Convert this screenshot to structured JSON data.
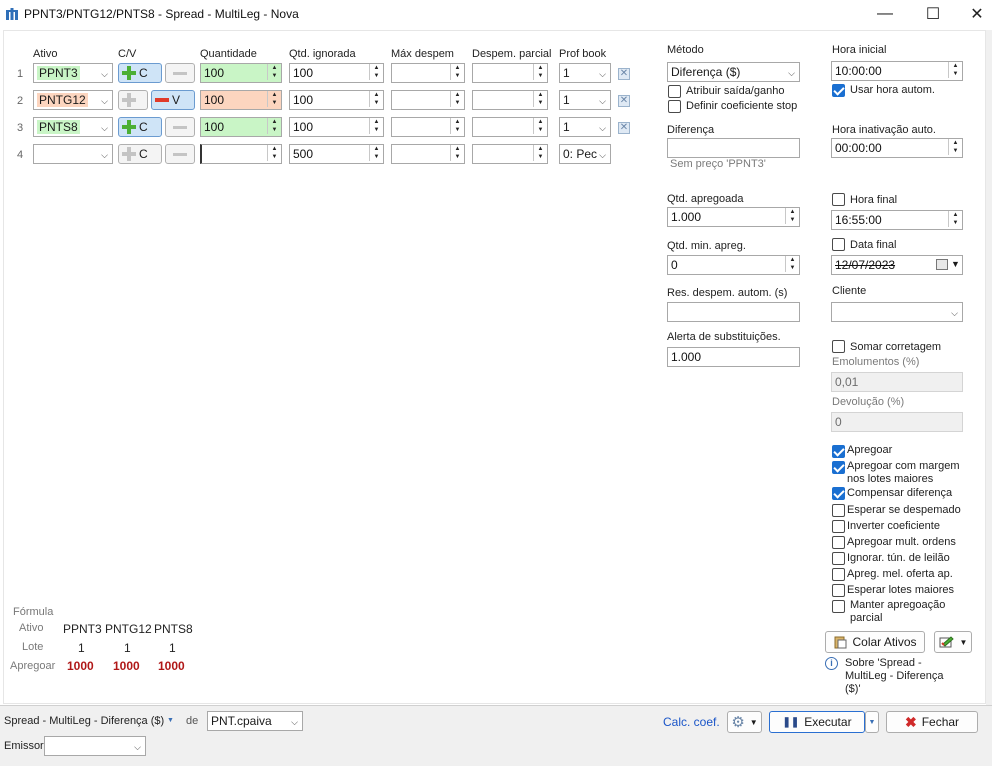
{
  "window": {
    "title": "PPNT3/PNTG12/PNTS8 - Spread - MultiLeg - Nova",
    "min_glyph": "—",
    "max_glyph": "☐",
    "close_glyph": "✕"
  },
  "legs": {
    "headers": {
      "ativo": "Ativo",
      "cv": "C/V",
      "quantidade": "Quantidade",
      "qtd_ignorada": "Qtd. ignorada",
      "max_despem": "Máx despem",
      "despem_parcial": "Despem. parcial",
      "prof_book": "Prof book"
    },
    "rows": [
      {
        "num": "1",
        "ativo": "PPNT3",
        "cv": "C",
        "quantidade": "100",
        "qtd_ignorada": "100",
        "max_despem": "",
        "despem_parcial": "",
        "prof_book": "1"
      },
      {
        "num": "2",
        "ativo": "PNTG12",
        "cv": "V",
        "quantidade": "100",
        "qtd_ignorada": "100",
        "max_despem": "",
        "despem_parcial": "",
        "prof_book": "1"
      },
      {
        "num": "3",
        "ativo": "PNTS8",
        "cv": "C",
        "quantidade": "100",
        "qtd_ignorada": "100",
        "max_despem": "",
        "despem_parcial": "",
        "prof_book": "1"
      },
      {
        "num": "4",
        "ativo": "",
        "cv": "C",
        "quantidade": "",
        "qtd_ignorada": "500",
        "max_despem": "",
        "despem_parcial": "",
        "prof_book": "0: Pec"
      }
    ],
    "c_label": "C",
    "v_label": "V"
  },
  "metodo": {
    "label": "Método",
    "value": "Diferença ($)",
    "atribuir": "Atribuir saída/ganho",
    "definir": "Definir coeficiente stop",
    "diferenca_label": "Diferença",
    "diferenca_value": "",
    "sem_preco": "Sem preço 'PPNT3'",
    "qtd_apregoada_label": "Qtd. apregoada",
    "qtd_apregoada": "1.000",
    "qtd_min_label": "Qtd. min. apreg.",
    "qtd_min": "0",
    "res_despem_label": "Res. despem. autom. (s)",
    "res_despem": "",
    "alerta_label": "Alerta de substituições.",
    "alerta": "1.000"
  },
  "tempo": {
    "hora_inicial_label": "Hora inicial",
    "hora_inicial": "10:00:00",
    "usar_hora": "Usar hora autom.",
    "hora_inativacao_label": "Hora inativação auto.",
    "hora_inativacao": "00:00:00",
    "hora_final_label": "Hora final",
    "hora_final": "16:55:00",
    "data_final_label": "Data final",
    "data_final": "12/07/2023",
    "cliente_label": "Cliente",
    "cliente": "",
    "somar_corretagem": "Somar corretagem",
    "emolumentos_label": "Emolumentos (%)",
    "emolumentos": "0,01",
    "devolucao_label": "Devolução (%)",
    "devolucao": "0"
  },
  "options": [
    {
      "label": "Apregoar",
      "checked": true
    },
    {
      "label": "Apregoar com margem nos lotes maiores",
      "checked": true
    },
    {
      "label": "Compensar diferença",
      "checked": true
    },
    {
      "label": "Esperar se despemado",
      "checked": false
    },
    {
      "label": "Inverter coeficiente",
      "checked": false
    },
    {
      "label": "Apregoar mult. ordens",
      "checked": false
    },
    {
      "label": "Ignorar. tún. de leilão",
      "checked": false
    },
    {
      "label": "Apreg. mel. oferta ap.",
      "checked": false
    },
    {
      "label": "Esperar lotes maiores",
      "checked": false
    },
    {
      "label": "Manter apregoação parcial",
      "checked": false
    }
  ],
  "colar_ativos": "Colar Ativos",
  "sobre": "Sobre 'Spread - MultiLeg - Diferença ($)'",
  "formula": {
    "title": "Fórmula",
    "ativo_label": "Ativo",
    "lote_label": "Lote",
    "apregoar_label": "Apregoar",
    "columns": [
      {
        "ativo": "PPNT3",
        "lote": "1",
        "apregoar": "1000"
      },
      {
        "ativo": "PNTG12",
        "lote": "1",
        "apregoar": "1000"
      },
      {
        "ativo": "PNTS8",
        "lote": "1",
        "apregoar": "1000"
      }
    ]
  },
  "bottom": {
    "strategy": "Spread - MultiLeg - Diferença ($)",
    "de": "de",
    "account": "PNT.cpaiva",
    "calc_coef": "Calc. coef.",
    "executar": "Executar",
    "fechar": "Fechar",
    "emissor_label": "Emissor",
    "emissor": ""
  }
}
